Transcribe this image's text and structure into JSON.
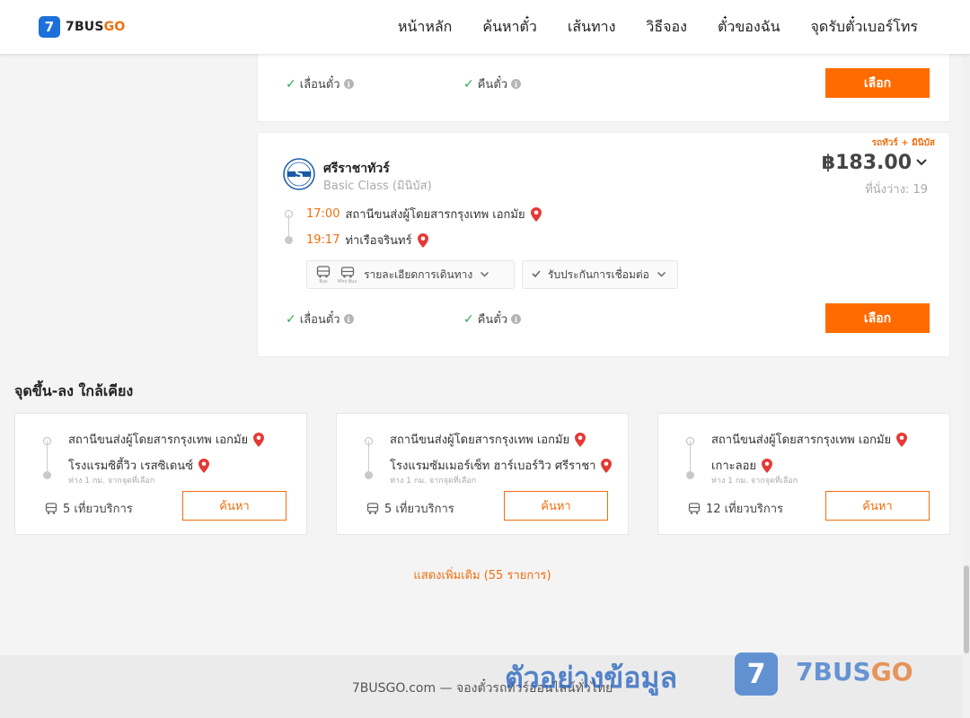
{
  "brand": {
    "badge": "7",
    "name_main": "7BUS",
    "name_accent": "GO",
    "accent_color": "#f26e0d",
    "primary_color": "#1e6fd9"
  },
  "nav": [
    "หน้าหลัก",
    "ค้นหาตั๋ว",
    "เส้นทาง",
    "วิธีจอง",
    "ตั๋วของฉัน",
    "จุดรับตั๋วเบอร์โทร"
  ],
  "trips": [
    {
      "features": {
        "reschedule": "เลื่อนตั๋ว",
        "refund": "คืนตั๋ว"
      },
      "select_label": "เลือก"
    },
    {
      "tag": "รถทัวร์ + มินิบัส",
      "operator": "ศรีราชาทัวร์",
      "class": "Basic Class (มินิบัส)",
      "price": "฿183.00",
      "seats": "ที่นั่งว่าง: 19",
      "depart_time": "17:00",
      "depart_stop": "สถานีขนส่งผู้โดยสารกรุงเทพ เอกมัย",
      "arrive_time": "19:17",
      "arrive_stop": "ท่าเรือจรินทร์",
      "bus_label": "Bus",
      "minibus_label": "Mini Bus",
      "details_label": "รายละเอียดการเดินทาง",
      "guarantee_label": "รับประกันการเชื่อมต่อ",
      "features": {
        "reschedule": "เลื่อนตั๋ว",
        "refund": "คืนตั๋ว"
      },
      "select_label": "เลือก"
    }
  ],
  "nearby": {
    "title": "จุดขึ้น-ลง ใกล้เคียง",
    "cards": [
      {
        "from": "สถานีขนส่งผู้โดยสารกรุงเทพ เอกมัย",
        "to": "โรงแรมซิตี้วิว เรสซิเดนซ์",
        "distance": "ห่าง 1 กม. จากจุดที่เลือก",
        "trips": "5 เที่ยวบริการ",
        "search_label": "ค้นหา"
      },
      {
        "from": "สถานีขนส่งผู้โดยสารกรุงเทพ เอกมัย",
        "to": "โรงแรมซัมเมอร์เซ็ท ฮาร์เบอร์วิว ศรีราชา",
        "distance": "ห่าง 1 กม. จากจุดที่เลือก",
        "trips": "5 เที่ยวบริการ",
        "search_label": "ค้นหา"
      },
      {
        "from": "สถานีขนส่งผู้โดยสารกรุงเทพ เอกมัย",
        "to": "เกาะลอย",
        "distance": "ห่าง 1 กม. จากจุดที่เลือก",
        "trips": "12 เที่ยวบริการ",
        "search_label": "ค้นหา"
      }
    ],
    "more_label": "แสดงเพิ่มเติม (55 รายการ)"
  },
  "footer": {
    "text": "7BUSGO.com — จองตั๋วรถทัวร์ออนไลน์ทั่วไทย"
  },
  "watermark": {
    "text": "ตัวอย่างข้อมูล",
    "badge": "7",
    "logo_main": "7BUS",
    "logo_accent": "GO"
  },
  "icons": {
    "check": "✓",
    "info": "i",
    "chevron": "⌄",
    "pin": "map-pin-icon",
    "bus": "bus-icon"
  }
}
